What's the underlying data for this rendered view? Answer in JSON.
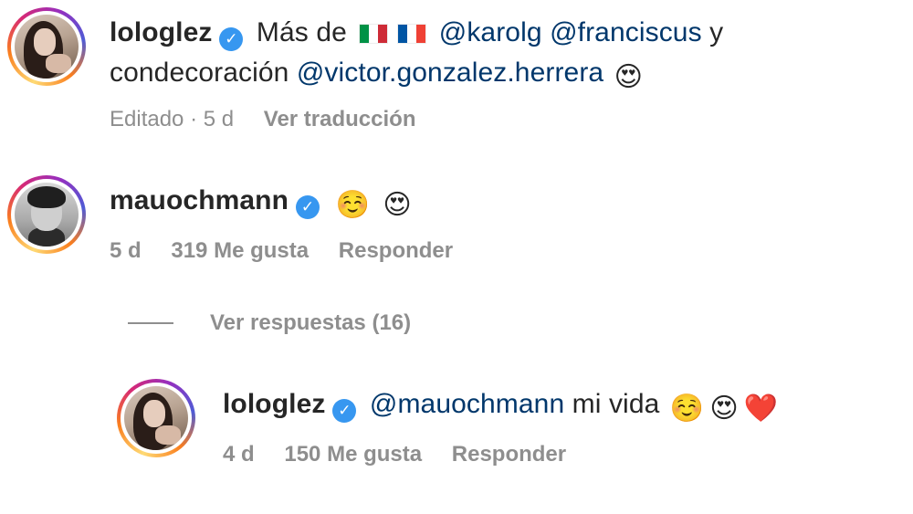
{
  "comments": [
    {
      "username": "lologlez",
      "text_prefix": "Más de",
      "flags": [
        "flag-italy",
        "flag-france"
      ],
      "mentions_line1": [
        "@karolg",
        "@franciscus"
      ],
      "conjunction": "y",
      "line2_text": "condecoración",
      "mention_line2": "@victor.gonzalez.herrera",
      "emoji": "😍",
      "meta": {
        "edited": "Editado · 5 d",
        "translate": "Ver traducción"
      }
    },
    {
      "username": "mauochmann",
      "emojis": [
        "☺️",
        "😍"
      ],
      "meta": {
        "time": "5 d",
        "likes": "319 Me gusta",
        "reply": "Responder"
      }
    }
  ],
  "view_replies": "Ver respuestas (16)",
  "reply": {
    "username": "lologlez",
    "mention": "@mauochmann",
    "text": "mi vida",
    "emojis": [
      "☺️",
      "😍",
      "❤️"
    ],
    "meta": {
      "time": "4 d",
      "likes": "150 Me gusta",
      "reply": "Responder"
    }
  },
  "colors": {
    "verified": "#3797f0",
    "mention": "#00376b",
    "meta": "#8e8e8e"
  }
}
